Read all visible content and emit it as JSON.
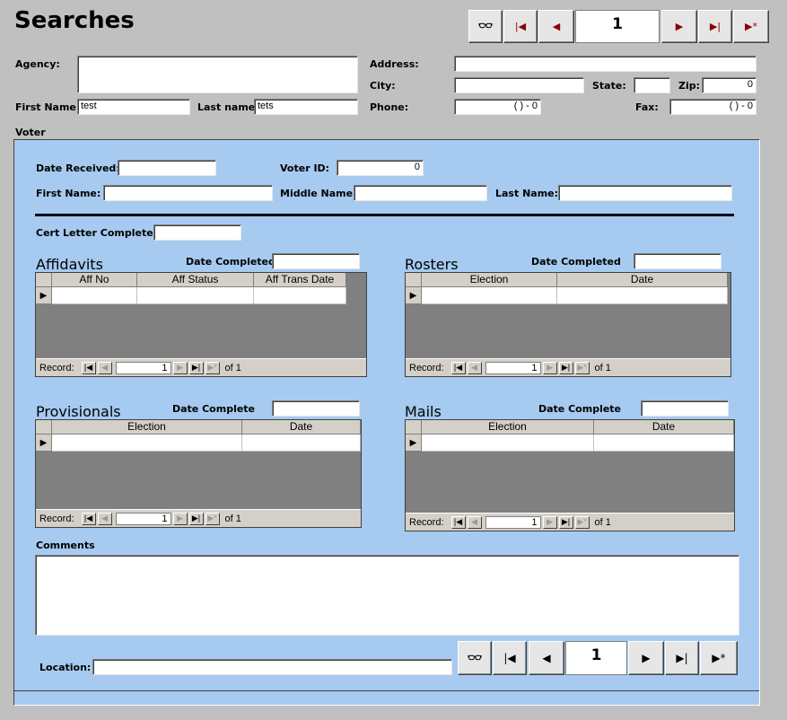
{
  "form": {
    "title": "Searches",
    "record_number": "1",
    "labels": {
      "agency": "Agency:",
      "address": "Address:",
      "city": "City:",
      "state": "State:",
      "zip": "Zip:",
      "first_name": "First Name:",
      "last_name": "Last name:",
      "phone": "Phone:",
      "fax": "Fax:"
    },
    "values": {
      "agency": "",
      "address": "",
      "city": "",
      "state": "",
      "zip": "0",
      "first_name": "test",
      "last_name": "tets",
      "phone": "(   )   -   0",
      "fax": "(   )   -   0"
    }
  },
  "voter": {
    "title": "Voter",
    "labels": {
      "date_received": "Date Received:",
      "voter_id": "Voter ID:",
      "first_name": "First Name:",
      "middle_name": "Middle Name:",
      "last_name": "Last Name:",
      "cert_letter": "Cert Letter Complete:",
      "comments": "Comments",
      "location": "Location:"
    },
    "values": {
      "date_received": "",
      "voter_id": "0",
      "first_name": "",
      "middle_name": "",
      "last_name": "",
      "cert_letter": "",
      "comments": "",
      "location": ""
    },
    "record_number": "1"
  },
  "subforms": {
    "affidavits": {
      "title": "Affidavits",
      "date_label": "Date Completed",
      "columns": [
        "Aff No",
        "Aff Status",
        "Aff Trans Date"
      ],
      "record_label": "Record:",
      "record_value": "1",
      "record_of": "of  1"
    },
    "rosters": {
      "title": "Rosters",
      "date_label": "Date Completed",
      "columns": [
        "Election",
        "Date"
      ],
      "record_label": "Record:",
      "record_value": "1",
      "record_of": "of  1"
    },
    "provisionals": {
      "title": "Provisionals",
      "date_label": "Date Complete",
      "columns": [
        "Election",
        "Date"
      ],
      "record_label": "Record:",
      "record_value": "1",
      "record_of": "of  1"
    },
    "mails": {
      "title": "Mails",
      "date_label": "Date Complete",
      "columns": [
        "Election",
        "Date"
      ],
      "record_label": "Record:",
      "record_value": "1",
      "record_of": "of  1"
    }
  },
  "icons": {
    "find": "binoculars-icon",
    "first": "first-record-icon",
    "prev": "previous-record-icon",
    "next": "next-record-icon",
    "last": "last-record-icon",
    "new": "new-record-icon"
  },
  "colors": {
    "form_background": "#c0c0c0",
    "section_background": "#a6caf0",
    "datasheet_background": "#808080"
  }
}
